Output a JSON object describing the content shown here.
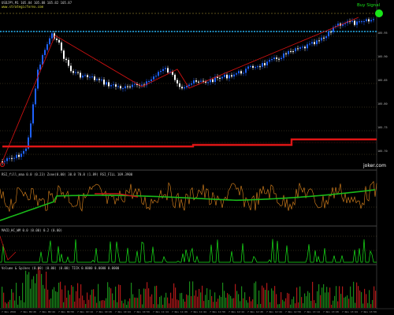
{
  "chart": {
    "header_title": "USDJPY,M1  105.84 105.88 105.82 105.87",
    "header_sub": "www.strategicforex.com",
    "signal_label": "Buy Signal",
    "watermark": "joker.com",
    "price_axis": [
      "105.95",
      "105.90",
      "105.85",
      "105.80",
      "105.75",
      "105.70"
    ],
    "time_axis": [
      "7 Nov 2016",
      "7 Nov 09:29",
      "7 Nov 09:44",
      "7 Nov 09:59",
      "7 Nov 10:14",
      "7 Nov 10:29",
      "7 Nov 10:44",
      "7 Nov 10:59",
      "7 Nov 11:14",
      "7 Nov 11:29",
      "7 Nov 11:44",
      "7 Nov 11:59",
      "7 Nov 12:14",
      "7 Nov 12:29",
      "7 Nov 12:44",
      "7 Nov 12:59",
      "7 Nov 13:14",
      "7 Nov 13:29",
      "7 Nov 13:44",
      "7 Nov 13:59"
    ]
  },
  "indicators": {
    "rsi_label": "RSI_fill_mma 0.0 (0.23) Zone(0.00) 30.0  70.0 (1.89) RSI_FILL 109.3900",
    "macd_label": "MACD_HC_WM 0.0 (0.00) 0.2 (0.00)",
    "volume_label": "Volume & Spikes (0.00) (0.00) (0.00) TICK 0.0000 0.0000 0.0000"
  },
  "colors": {
    "background": "#000000",
    "bull_candle": "#1e62ff",
    "bear_candle": "#ffffff",
    "trendline": "#cc1111",
    "support_line": "#29b6f6",
    "rsi_signal": "#19b919",
    "rsi_line": "#e68a1f",
    "macd_line": "#19e619",
    "volume_up": "#1a8a1a",
    "volume_down": "#b01919"
  }
}
